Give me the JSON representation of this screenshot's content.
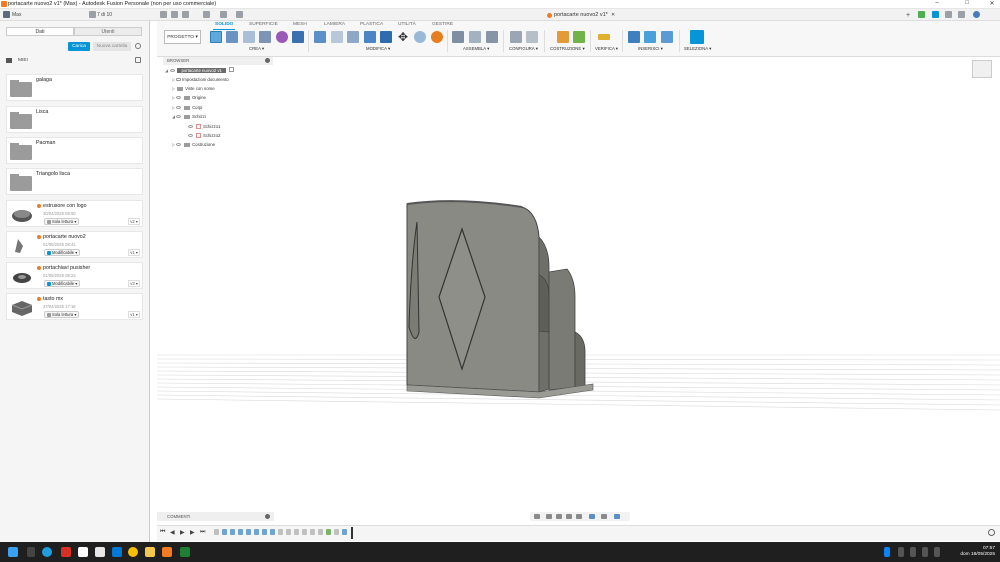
{
  "window": {
    "title": "portacarte nuovo2 v1* (Max) - Autodesk Fusion Personale (non per uso commerciale)",
    "minimize": "–",
    "maximize": "□",
    "close": "✕"
  },
  "toolbar": {
    "user": "Max",
    "version_counter": "7 di 10",
    "document_tab": "portacarte nuovo2 v1*",
    "tab_close": "✕",
    "new_tab": "+"
  },
  "ribbon": {
    "tabs": [
      "SOLIDO",
      "SUPERFICIE",
      "MESH",
      "LAMIERA",
      "PLASTICA",
      "UTILITÀ",
      "GESTIRE"
    ],
    "workspace_button": "PROGETTO ▾",
    "groups": [
      "CREA ▾",
      "MODIFICA ▾",
      "ASSEMBLA ▾",
      "CONFIGURA ▾",
      "COSTRUZIONE ▾",
      "VERIFICA ▾",
      "INSERISCI ▾",
      "SELEZIONA ▾"
    ]
  },
  "data_panel": {
    "tab_data": "Dati",
    "tab_people": "Utenti",
    "upload": "Carica",
    "new_folder": "Nuova cartella",
    "breadcrumb": "MIEI",
    "folders": [
      "galaga",
      "Lisca",
      "Pacman",
      "Triangolo lisca"
    ],
    "files": [
      {
        "name": "estrusore con logo",
        "date": "30/04/2025 08:50",
        "badge": "Sola lettura ▾",
        "badge_color": "#9b9b9b",
        "version": "v2 ▾"
      },
      {
        "name": "portacarte nuovo2",
        "date": "01/05/2025 08:41",
        "badge": "Modificabile ▾",
        "badge_color": "#0696d7",
        "version": "v1 ▾"
      },
      {
        "name": "portachiavi pusisher",
        "date": "01/05/2025 08:23",
        "badge": "Modificabile ▾",
        "badge_color": "#0696d7",
        "version": "v3 ▾"
      },
      {
        "name": "tasto mx",
        "date": "27/04/2025 17:16",
        "badge": "Sola lettura ▾",
        "badge_color": "#9b9b9b",
        "version": "v1 ▾"
      }
    ]
  },
  "browser": {
    "header": "BROWSER",
    "root": "portacarte nuovo2 v1",
    "items": [
      "Impostazioni documento",
      "Viste con nome",
      "Origine",
      "Corpi",
      "Schizzi",
      "Schizzo1",
      "Schizzo2",
      "Costruzione"
    ]
  },
  "comments": "COMMENTI",
  "taskbar": {
    "time": "07:57",
    "date": "dom 18/05/2025"
  }
}
